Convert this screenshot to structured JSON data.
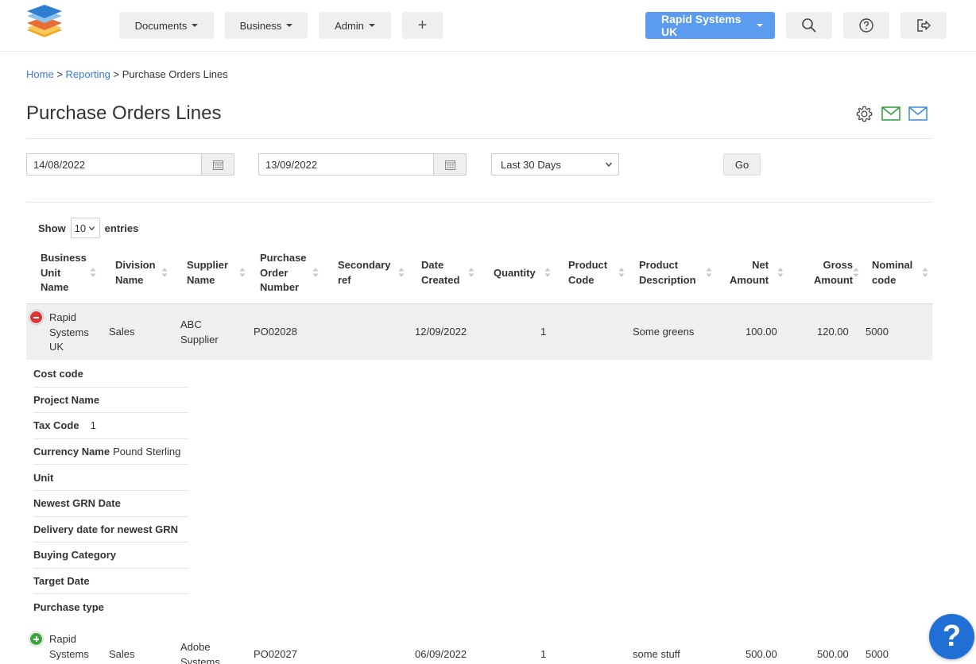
{
  "colors": {
    "accent": "#5b9bf0",
    "link": "#3a7bd5",
    "remove": "#dd3333",
    "add": "#3aa63a",
    "help": "#1f6fd4"
  },
  "nav": {
    "documents": "Documents",
    "business": "Business",
    "admin": "Admin",
    "add_icon": "+",
    "company": "Rapid Systems UK",
    "icons": [
      "search-icon",
      "help-circle-icon",
      "logout-icon"
    ]
  },
  "breadcrumb": {
    "home": "Home",
    "sep": ">",
    "reporting": "Reporting",
    "current": "Purchase Orders Lines"
  },
  "page": {
    "title": "Purchase Orders Lines",
    "tools": [
      "settings-icon",
      "email-green-icon",
      "email-blue-icon"
    ]
  },
  "filters": {
    "date_from": "14/08/2022",
    "date_to": "13/09/2022",
    "range": "Last 30 Days",
    "go": "Go"
  },
  "entries": {
    "show": "Show",
    "value": "10",
    "suffix": "entries"
  },
  "table": {
    "headers": [
      [
        "Business",
        "Unit",
        "Name"
      ],
      [
        "Division",
        "Name"
      ],
      [
        "Supplier",
        "Name"
      ],
      [
        "Purchase",
        "Order",
        "Number"
      ],
      [
        "Secondary",
        "ref"
      ],
      [
        "Date",
        "Created"
      ],
      [
        "Quantity"
      ],
      [
        "Product",
        "Code"
      ],
      [
        "Product",
        "Description"
      ],
      [
        "Net",
        "Amount"
      ],
      [
        "Gross",
        "Amount"
      ],
      [
        "Nominal",
        "code"
      ]
    ],
    "rows": [
      {
        "business_unit": [
          "Rapid",
          "Systems",
          "UK"
        ],
        "division": "Sales",
        "supplier": [
          "ABC",
          "Supplier"
        ],
        "po_number": "PO02028",
        "secondary_ref": "",
        "date_created": "12/09/2022",
        "quantity": "1",
        "product_code": "",
        "description": "Some greens",
        "net": "100.00",
        "gross": "120.00",
        "nominal": "5000"
      },
      {
        "business_unit": [
          "Rapid",
          "Systems"
        ],
        "division": "Sales",
        "supplier": [
          "Adobe",
          "Systems"
        ],
        "po_number": "PO02027",
        "secondary_ref": "",
        "date_created": "06/09/2022",
        "quantity": "1",
        "product_code": "",
        "description": "some stuff",
        "net": "500.00",
        "gross": "500.00",
        "nominal": "5000"
      }
    ],
    "detail": [
      {
        "key": "Cost code",
        "value": ""
      },
      {
        "key": "Project Name",
        "value": ""
      },
      {
        "key": "Tax Code",
        "value": "1"
      },
      {
        "key": "Currency Name",
        "value": "Pound Sterling"
      },
      {
        "key": "Unit",
        "value": ""
      },
      {
        "key": "Newest GRN Date",
        "value": ""
      },
      {
        "key": "Delivery date for newest GRN",
        "value": ""
      },
      {
        "key": "Buying Category",
        "value": ""
      },
      {
        "key": "Target Date",
        "value": ""
      },
      {
        "key": "Purchase type",
        "value": ""
      }
    ]
  },
  "help_fab": "?"
}
